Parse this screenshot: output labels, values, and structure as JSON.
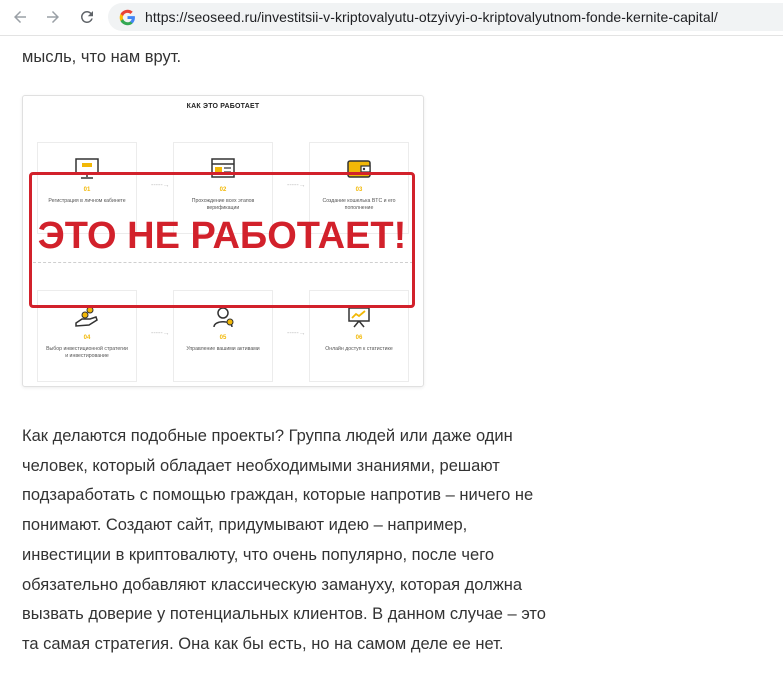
{
  "browser": {
    "url": "https://seoseed.ru/investitsii-v-kriptovalyutu-otzyivyi-o-kriptovalyutnom-fonde-kernite-capital/"
  },
  "article": {
    "lead": "мысль, что нам врут.",
    "figure": {
      "title": "КАК ЭТО РАБОТАЕТ",
      "steps": [
        {
          "num": "01",
          "text": "Регистрация в личном кабинете",
          "icon": "monitor-icon"
        },
        {
          "num": "02",
          "text": "Прохождение всех этапов верификации",
          "icon": "browser-window-icon"
        },
        {
          "num": "03",
          "text": "Создание кошелька BTC и его пополнение",
          "icon": "wallet-icon"
        },
        {
          "num": "04",
          "text": "Выбор инвестиционной стратегии и инвестирование",
          "icon": "hand-coins-icon"
        },
        {
          "num": "05",
          "text": "Управление вашими активами",
          "icon": "user-gear-icon"
        },
        {
          "num": "06",
          "text": "Онлайн доступ к статистике",
          "icon": "presentation-chart-icon"
        }
      ],
      "stamp": "ЭТО НЕ РАБОТАЕТ!"
    },
    "paragraph": [
      "Как делаются подобные проекты? Группа людей или даже один",
      "человек, который обладает необходимыми знаниями, решают",
      "подзаработать с помощью граждан, которые напротив – ничего не",
      "понимают. Создают сайт, придумывают идею – например,",
      "инвестиции в криптовалюту, что очень популярно, после чего",
      "обязательно добавляют классическую замануху, которая должна",
      "вызвать доверие у потенциальных клиентов. В данном случае – это",
      "та самая стратегия. Она как бы есть, но на самом деле ее нет."
    ]
  },
  "colors": {
    "stamp_red": "#d2212b",
    "step_accent": "#f2b807",
    "text": "#333333"
  }
}
